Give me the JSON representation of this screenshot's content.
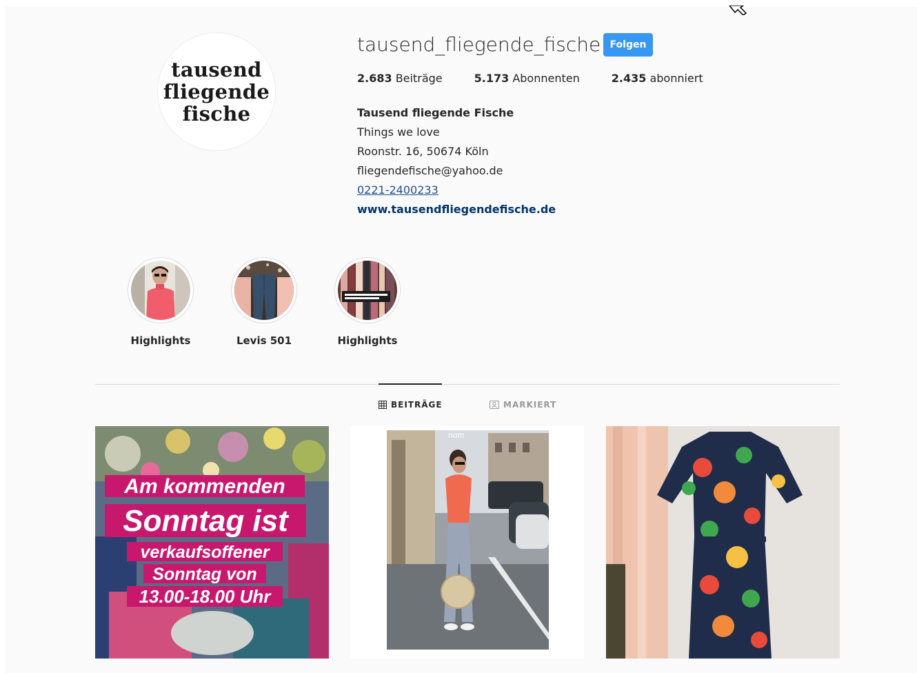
{
  "profile": {
    "username": "tausend_fliegende_fische",
    "follow_label": "Folgen",
    "avatar_logo": [
      "tausend",
      "fliegende",
      "fische"
    ],
    "stats": {
      "posts_count": "2.683",
      "posts_label": "Beiträge",
      "followers_count": "5.173",
      "followers_label": "Abonnenten",
      "following_count": "2.435",
      "following_label": "abonniert"
    },
    "bio": {
      "name": "Tausend fliegende Fische",
      "line1": "Things we love",
      "line2": "Roonstr. 16, 50674 Köln",
      "line3": "fliegendefische@yahoo.de",
      "phone": "0221-2400233",
      "website": "www.tausendfliegendefische.de"
    }
  },
  "highlights": [
    {
      "label": "Highlights"
    },
    {
      "label": "Levis 501"
    },
    {
      "label": "Highlights"
    }
  ],
  "tabs": {
    "posts": "BEITRÄGE",
    "tagged": "MARKIERT"
  },
  "posts": [
    {
      "overlay_lines": [
        "Am kommenden",
        "Sonntag ist",
        "verkaufsoffener",
        "Sonntag von",
        "13.00-18.00 Uhr"
      ]
    },
    {
      "sign_text": "nom"
    },
    {}
  ],
  "colors": {
    "accent": "#3897f0",
    "overlay_magenta": "#c8186e",
    "link": "#003569"
  }
}
